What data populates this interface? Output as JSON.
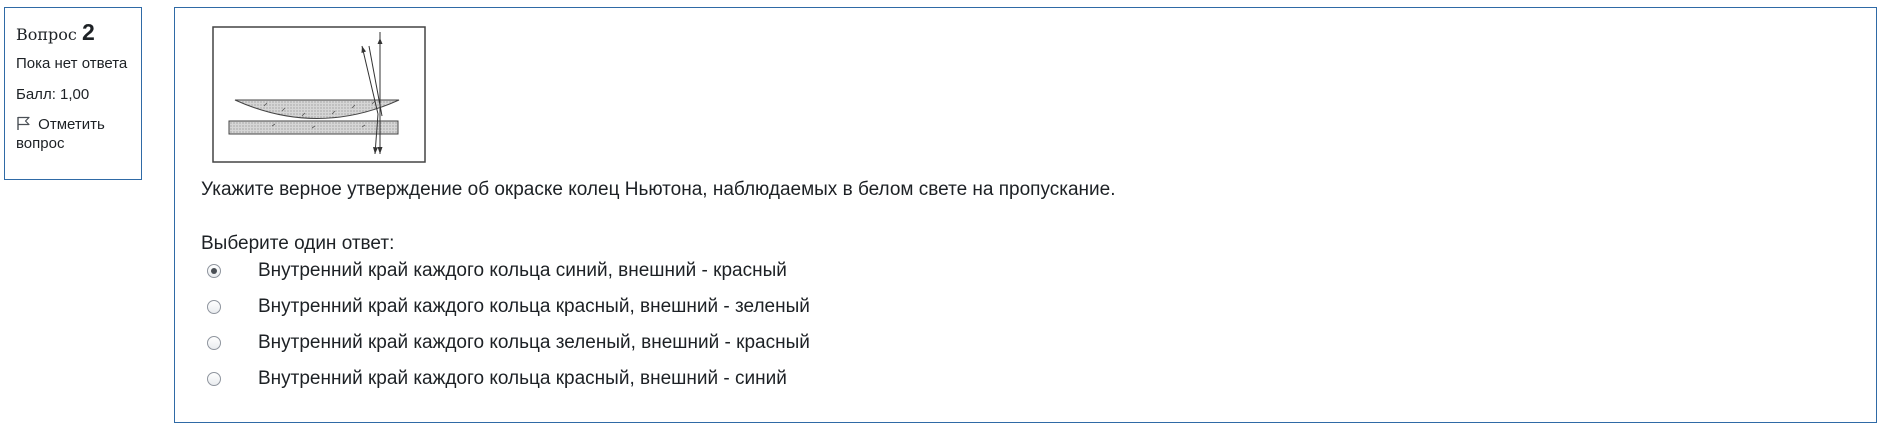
{
  "question_info": {
    "label": "Вопрос",
    "number": "2",
    "state": "Пока нет ответа",
    "grade": "Балл: 1,00",
    "flag_label": "Отметить вопрос"
  },
  "question": {
    "text": "Укажите верное утверждение об окраске колец Ньютона, наблюдаемых в белом свете на пропускание.",
    "prompt": "Выберите один ответ:",
    "answers": [
      {
        "label": "Внутренний край каждого кольца синий, внешний - красный",
        "checked": true
      },
      {
        "label": "Внутренний край каждого кольца красный, внешний - зеленый",
        "checked": false
      },
      {
        "label": "Внутренний край каждого кольца зеленый, внешний - красный",
        "checked": false
      },
      {
        "label": "Внутренний край каждого кольца красный, внешний - синий",
        "checked": false
      }
    ]
  },
  "icons": {
    "flag": "flag-icon",
    "figure": "newton-rings-figure"
  }
}
